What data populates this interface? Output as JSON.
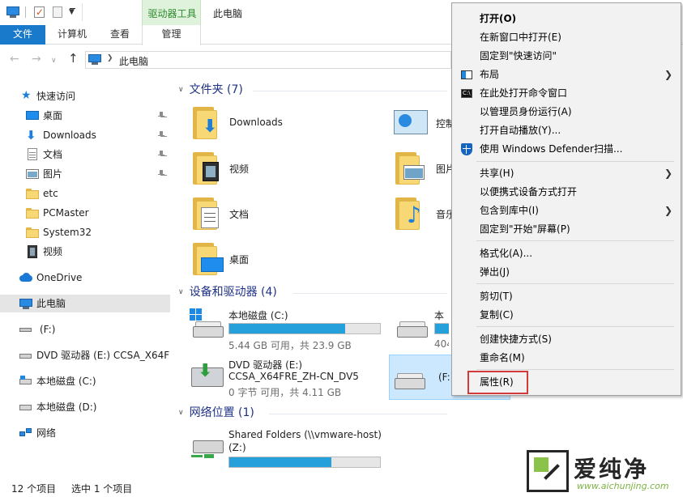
{
  "window": {
    "title": "此电脑",
    "context_tab_header": "驱动器工具"
  },
  "ribbon": {
    "tabs": [
      "文件",
      "计算机",
      "查看",
      "管理"
    ]
  },
  "address": {
    "path": "此电脑"
  },
  "nav": {
    "items": [
      {
        "label": "快速访问",
        "icon": "star-icon"
      },
      {
        "label": "桌面",
        "icon": "desktop-icon",
        "pinned": true
      },
      {
        "label": "Downloads",
        "icon": "download-icon",
        "pinned": true
      },
      {
        "label": "文档",
        "icon": "document-icon",
        "pinned": true
      },
      {
        "label": "图片",
        "icon": "picture-icon",
        "pinned": true
      },
      {
        "label": "etc",
        "icon": "folder-icon"
      },
      {
        "label": "PCMaster",
        "icon": "folder-icon"
      },
      {
        "label": "System32",
        "icon": "folder-icon"
      },
      {
        "label": "视频",
        "icon": "video-icon"
      },
      {
        "label": "OneDrive",
        "icon": "cloud-icon"
      },
      {
        "label": "此电脑",
        "icon": "pc-icon",
        "selected": true
      },
      {
        "label": "(F:)",
        "icon": "drive-icon"
      },
      {
        "label": "DVD 驱动器 (E:) CCSA_X64FR",
        "icon": "dvd-icon"
      },
      {
        "label": "本地磁盘 (C:)",
        "icon": "hdd-icon"
      },
      {
        "label": "本地磁盘 (D:)",
        "icon": "hdd-icon"
      },
      {
        "label": "网络",
        "icon": "network-icon"
      }
    ]
  },
  "content": {
    "groups": {
      "folders": "文件夹 (7)",
      "devices": "设备和驱动器 (4)",
      "network": "网络位置 (1)"
    },
    "folders": [
      "Downloads",
      "视频",
      "文档",
      "桌面",
      "控制",
      "图片",
      "音乐"
    ],
    "drives": [
      {
        "name": "本地磁盘 (C:)",
        "info": "5.44 GB 可用，共 23.9 GB",
        "used_fraction": 0.77
      },
      {
        "name": "本",
        "info": "404",
        "used_fraction": 0.3
      },
      {
        "name": "DVD 驱动器 (E:)",
        "name2": "CCSA_X64FRE_ZH-CN_DV5",
        "info": "0 字节 可用，共 4.11 GB"
      },
      {
        "name": "(F:)"
      }
    ],
    "network": {
      "name": "Shared Folders (\\\\vmware-host)",
      "name2": "(Z:)",
      "used_fraction": 0.68
    }
  },
  "context_menu": {
    "items": [
      "打开(O)",
      "在新窗口中打开(E)",
      "固定到\"快速访问\"",
      "布局",
      "在此处打开命令窗口",
      "以管理员身份运行(A)",
      "打开自动播放(Y)...",
      "使用 Windows Defender扫描...",
      "共享(H)",
      "以便携式设备方式打开",
      "包含到库中(I)",
      "固定到\"开始\"屏幕(P)",
      "格式化(A)...",
      "弹出(J)",
      "剪切(T)",
      "复制(C)",
      "创建快捷方式(S)",
      "重命名(M)",
      "属性(R)"
    ]
  },
  "status": {
    "count": "12 个项目",
    "selected": "选中 1 个项目"
  },
  "watermark": {
    "text": "爱纯净",
    "url": "www.aichunjing.com"
  },
  "colors": {
    "accent": "#1979ca",
    "context_tab": "#dff3dc",
    "selection": "#cce8ff",
    "bar_fill": "#26a0da",
    "highlight_box": "#d33b3b"
  }
}
